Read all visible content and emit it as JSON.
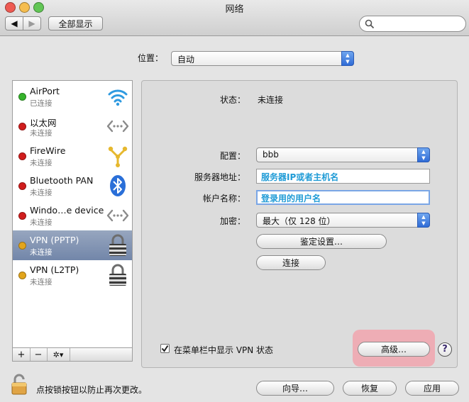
{
  "window": {
    "title": "网络",
    "show_all_label": "全部显示"
  },
  "location": {
    "label": "位置：",
    "value": "自动"
  },
  "services": [
    {
      "name": "AirPort",
      "status": "已连接",
      "dot_color": "#35b32b",
      "icon": "wifi-icon",
      "selected": false
    },
    {
      "name": "以太网",
      "status": "未连接",
      "dot_color": "#d01d1d",
      "icon": "ethernet-icon",
      "selected": false
    },
    {
      "name": "FireWire",
      "status": "未连接",
      "dot_color": "#d01d1d",
      "icon": "firewire-icon",
      "selected": false
    },
    {
      "name": "Bluetooth PAN",
      "status": "未连接",
      "dot_color": "#d01d1d",
      "icon": "bluetooth-icon",
      "selected": false
    },
    {
      "name": "Windo…e device",
      "status": "未连接",
      "dot_color": "#d01d1d",
      "icon": "ethernet-icon",
      "selected": false
    },
    {
      "name": "VPN (PPTP)",
      "status": "未连接",
      "dot_color": "#e2a51c",
      "icon": "lock-icon",
      "selected": true
    },
    {
      "name": "VPN (L2TP)",
      "status": "未连接",
      "dot_color": "#e2a51c",
      "icon": "lock-icon",
      "selected": false
    }
  ],
  "list_controls": {
    "add": "+",
    "remove": "−",
    "action": "✲▾"
  },
  "detail": {
    "status_label": "状态：",
    "status_value": "未连接",
    "config_label": "配置：",
    "config_value": "bbb",
    "server_label": "服务器地址：",
    "server_value": "服务器IP或者主机名",
    "account_label": "帐户名称：",
    "account_value": "登录用的用户名",
    "encryption_label": "加密：",
    "encryption_value": "最大（仅 128 位）",
    "auth_button": "鉴定设置…",
    "connect_button": "连接",
    "show_menu_label": "在菜单栏中显示 VPN 状态",
    "show_menu_checked": true,
    "advanced_button": "高级…",
    "help_button": "?"
  },
  "footer": {
    "lock_text": "点按锁按钮以防止再次更改。",
    "assist_button": "向导…",
    "revert_button": "恢复",
    "apply_button": "应用"
  },
  "colors": {
    "selection": "#7d8fb0",
    "highlight": "#f0a7b0",
    "field_value": "#1f9bd6"
  }
}
